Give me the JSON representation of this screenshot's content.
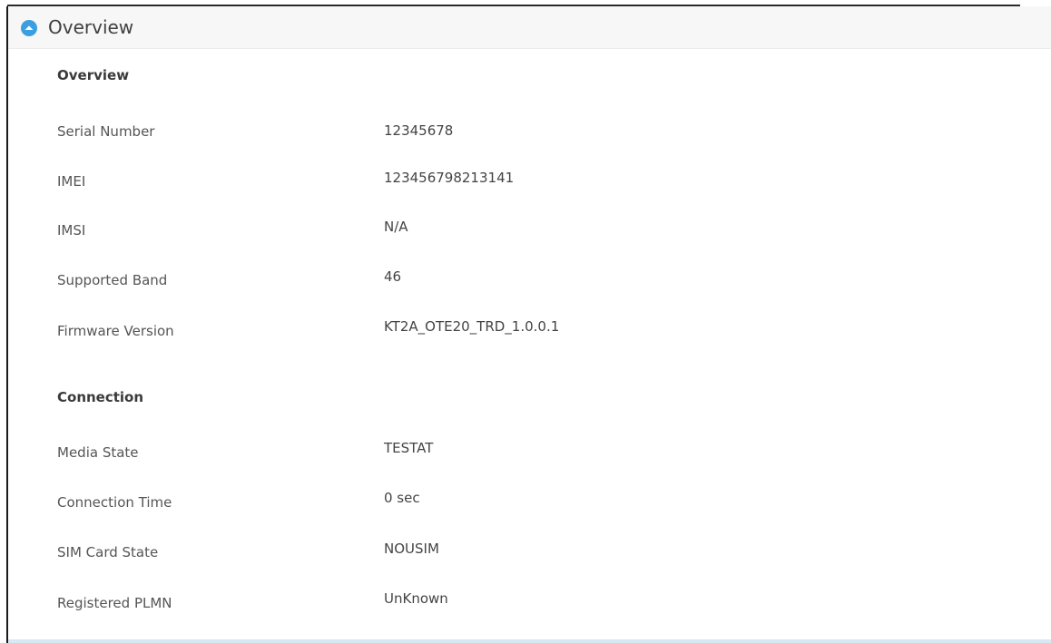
{
  "panel": {
    "title": "Overview",
    "collapse_icon": "chevron-up-circle-icon",
    "accent_color": "#3b9ee0"
  },
  "sections": [
    {
      "title": "Overview",
      "rows": [
        {
          "label": "Serial Number",
          "value": "12345678"
        },
        {
          "label": "IMEI",
          "value": "123456798213141"
        },
        {
          "label": "IMSI",
          "value": "N/A"
        },
        {
          "label": "Supported Band",
          "value": "46"
        },
        {
          "label": "Firmware Version",
          "value": "KT2A_OTE20_TRD_1.0.0.1"
        }
      ]
    },
    {
      "title": "Connection",
      "rows": [
        {
          "label": "Media State",
          "value": "TESTAT"
        },
        {
          "label": "Connection Time",
          "value": "0 sec"
        },
        {
          "label": "SIM Card State",
          "value": "NOUSIM"
        },
        {
          "label": "Registered PLMN",
          "value": "UnKnown"
        }
      ]
    }
  ]
}
